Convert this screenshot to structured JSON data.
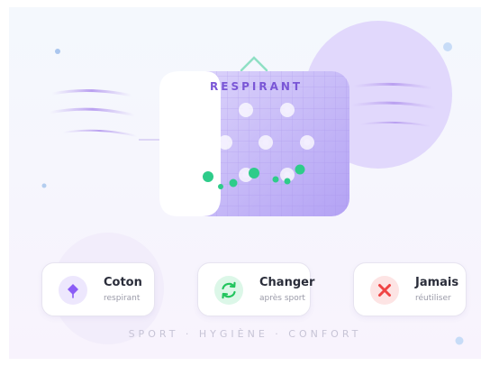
{
  "fabric": {
    "label": "RESPIRANT"
  },
  "features": [
    {
      "title": "Coton",
      "subtitle": "respirant",
      "icon": "cotton-flower-icon",
      "color": "#8b5cf6"
    },
    {
      "title": "Changer",
      "subtitle": "après sport",
      "icon": "refresh-icon",
      "color": "#22c55e"
    },
    {
      "title": "Jamais",
      "subtitle": "réutiliser",
      "icon": "close-icon",
      "color": "#ef4444"
    }
  ],
  "tagline": "SPORT · HYGIÈNE · CONFORT"
}
